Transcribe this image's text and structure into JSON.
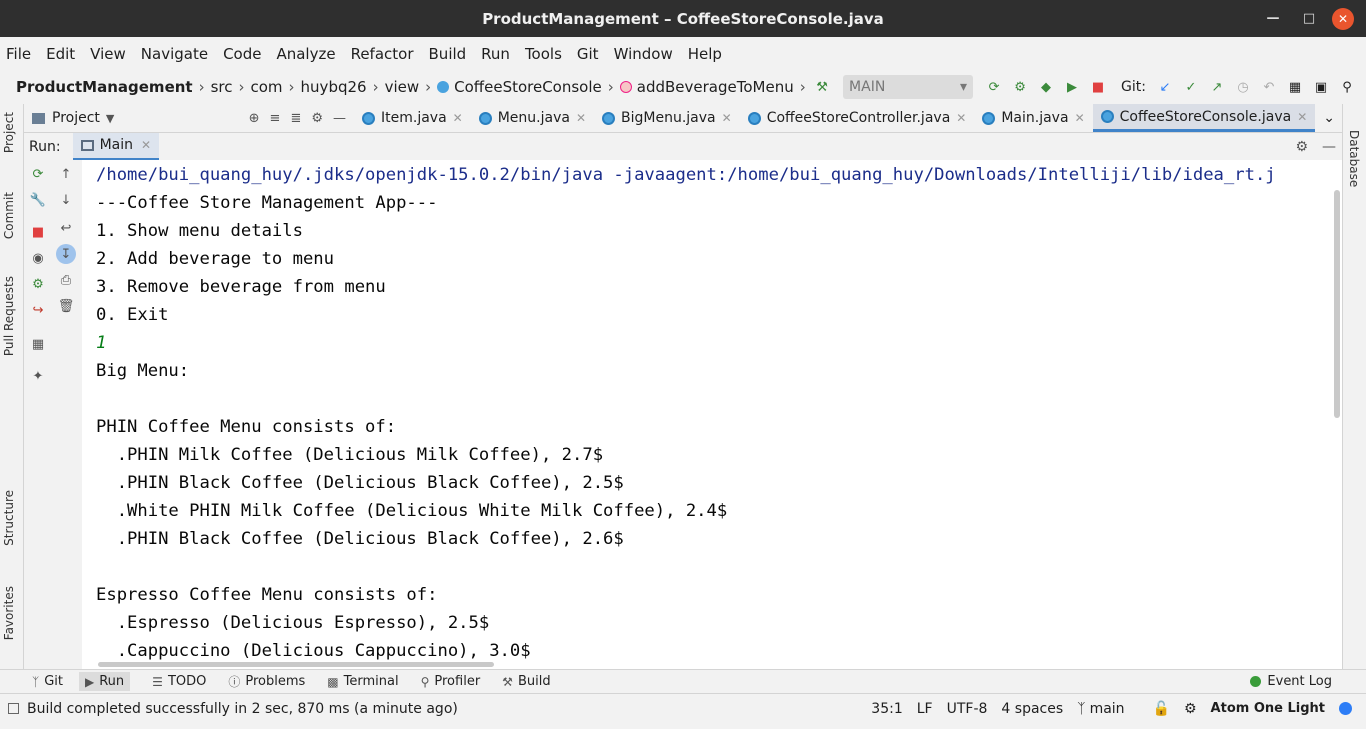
{
  "window": {
    "title": "ProductManagement – CoffeeStoreConsole.java"
  },
  "menu": [
    "File",
    "Edit",
    "View",
    "Navigate",
    "Code",
    "Analyze",
    "Refactor",
    "Build",
    "Run",
    "Tools",
    "Git",
    "Window",
    "Help"
  ],
  "breadcrumb": [
    "ProductManagement",
    "src",
    "com",
    "huybq26",
    "view",
    "CoffeeStoreConsole",
    "addBeverageToMenu"
  ],
  "toolbar": {
    "run_config": "MAIN",
    "git_label": "Git:"
  },
  "project_panel": {
    "title": "Project"
  },
  "editor_tabs": [
    "Item.java",
    "Menu.java",
    "BigMenu.java",
    "CoffeeStoreController.java",
    "Main.java",
    "CoffeeStoreConsole.java"
  ],
  "left_strip": [
    "Project",
    "Commit",
    "Pull Requests",
    "Structure",
    "Favorites"
  ],
  "right_strip": [
    "Database"
  ],
  "run": {
    "label": "Run:",
    "tab": "Main"
  },
  "console": {
    "command": "/home/bui_quang_huy/.jdks/openjdk-15.0.2/bin/java -javaagent:/home/bui_quang_huy/Downloads/Intelliji/lib/idea_rt.j",
    "lines": [
      "---Coffee Store Management App---",
      "1. Show menu details",
      "2. Add beverage to menu",
      "3. Remove beverage from menu",
      "0. Exit",
      "1",
      "Big Menu:",
      "",
      "PHIN Coffee Menu consists of:",
      "  .PHIN Milk Coffee (Delicious Milk Coffee), 2.7$",
      "  .PHIN Black Coffee (Delicious Black Coffee), 2.5$",
      "  .White PHIN Milk Coffee (Delicious White Milk Coffee), 2.4$",
      "  .PHIN Black Coffee (Delicious Black Coffee), 2.6$",
      "",
      "Espresso Coffee Menu consists of:",
      "  .Espresso (Delicious Espresso), 2.5$",
      "  .Cappuccino (Delicious Cappuccino), 3.0$"
    ]
  },
  "bottom_tools": [
    "Git",
    "Run",
    "TODO",
    "Problems",
    "Terminal",
    "Profiler",
    "Build"
  ],
  "event_log": "Event Log",
  "status": {
    "message": "Build completed successfully in 2 sec, 870 ms (a minute ago)",
    "position": "35:1",
    "line_sep": "LF",
    "encoding": "UTF-8",
    "indent": "4 spaces",
    "branch": "main",
    "theme": "Atom One Light"
  }
}
